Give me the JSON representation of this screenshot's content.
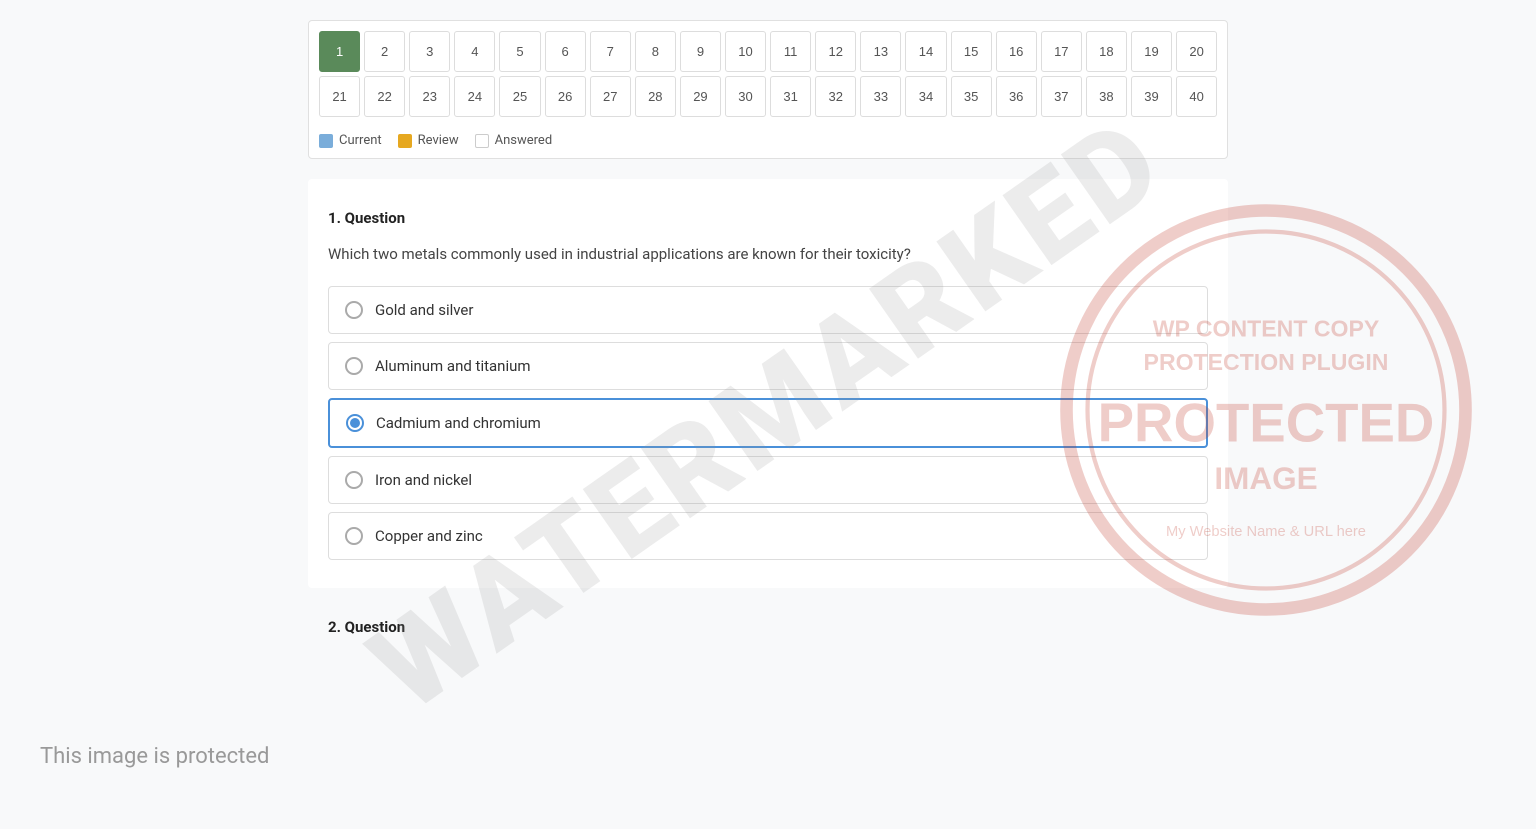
{
  "navigator": {
    "buttons": [
      1,
      2,
      3,
      4,
      5,
      6,
      7,
      8,
      9,
      10,
      11,
      12,
      13,
      14,
      15,
      16,
      17,
      18,
      19,
      20,
      21,
      22,
      23,
      24,
      25,
      26,
      27,
      28,
      29,
      30,
      31,
      32,
      33,
      34,
      35,
      36,
      37,
      38,
      39,
      40
    ],
    "current": 1,
    "legend": {
      "current": "Current",
      "review": "Review",
      "answered": "Answered"
    }
  },
  "question1": {
    "label": "1. Question",
    "text": "Which two metals commonly used in industrial applications are known for their toxicity?",
    "options": [
      {
        "id": "opt1",
        "text": "Gold and silver",
        "selected": false
      },
      {
        "id": "opt2",
        "text": "Aluminum and titanium",
        "selected": false
      },
      {
        "id": "opt3",
        "text": "Cadmium and chromium",
        "selected": true
      },
      {
        "id": "opt4",
        "text": "Iron and nickel",
        "selected": false
      },
      {
        "id": "opt5",
        "text": "Copper and zinc",
        "selected": false
      }
    ]
  },
  "question2": {
    "label": "2. Question"
  },
  "watermark": "WATERMARKED",
  "protected_text": "This image is protected"
}
